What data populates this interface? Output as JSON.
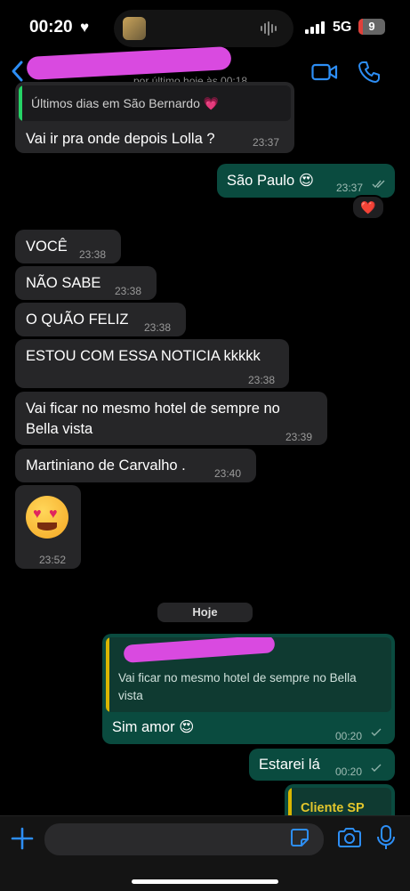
{
  "status_bar": {
    "time": "00:20",
    "network": "5G",
    "battery": "9"
  },
  "header": {
    "last_seen": "por último hoje às 00:18"
  },
  "messages": [
    {
      "quote_text": "Últimos dias em São Bernardo 💗",
      "text": "Vai ir pra onde depois Lolla ?",
      "time": "23:37"
    },
    {
      "text": "São Paulo 😍",
      "time": "23:37",
      "reaction": "❤️"
    },
    {
      "text": "VOCÊ",
      "time": "23:38"
    },
    {
      "text": "NÃO SABE",
      "time": "23:38"
    },
    {
      "text": "O QUÃO FELIZ",
      "time": "23:38"
    },
    {
      "text": "ESTOU COM ESSA NOTICIA kkkkk",
      "time": "23:38"
    },
    {
      "line1": "Vai ficar no mesmo hotel de sempre no",
      "line2": "Bella vista",
      "time": "23:39"
    },
    {
      "text": "Martiniano de Carvalho .",
      "time": "23:40"
    },
    {
      "emoji": "😍",
      "time": "23:52"
    }
  ],
  "date_divider": "Hoje",
  "today": [
    {
      "quote_line1": "Vai ficar no mesmo hotel de sempre no Bella",
      "quote_line2": "vista",
      "text": "Sim amor 😍",
      "time": "00:20"
    },
    {
      "text": "Estarei lá",
      "time": "00:20"
    },
    {
      "quote_title": "Cliente SP"
    }
  ],
  "colors": {
    "incoming_bubble": "#262628",
    "outgoing_bubble": "#0a4b3f",
    "accent_blue": "#2d8ef5",
    "quote_bar_green": "#25d366",
    "quote_bar_yellow": "#d9b600",
    "redaction_magenta": "#d94ae0"
  },
  "icons": [
    "back-chevron-icon",
    "video-call-icon",
    "phone-icon",
    "plus-icon",
    "sticker-icon",
    "camera-icon",
    "microphone-icon",
    "read-ticks-icon"
  ]
}
